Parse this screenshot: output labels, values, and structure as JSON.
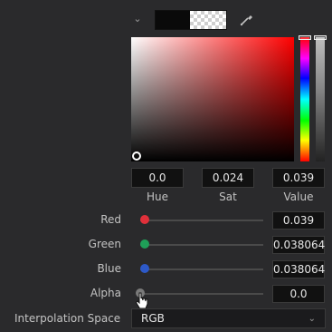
{
  "top": {
    "color_swatch_color": "#0a0a0a",
    "chevron_icon": "chevron-down-icon",
    "picker_icon": "eyedropper-icon"
  },
  "hsv": {
    "hue_value": "0.0",
    "sat_value": "0.024",
    "value_value": "0.039",
    "hue_label": "Hue",
    "sat_label": "Sat",
    "value_label": "Value"
  },
  "rows": {
    "red": {
      "label": "Red",
      "value": "0.039",
      "color": "#e0303a",
      "fraction": 0.039
    },
    "green": {
      "label": "Green",
      "value": "0.038064",
      "color": "#1fa058",
      "fraction": 0.038064
    },
    "blue": {
      "label": "Blue",
      "value": "0.038064",
      "color": "#2d59c8",
      "fraction": 0.038064
    },
    "alpha": {
      "label": "Alpha",
      "value": "0.0",
      "color": "#7a7a7a",
      "fraction": 0.0
    }
  },
  "interpolation": {
    "label": "Interpolation Space",
    "value": "RGB"
  }
}
